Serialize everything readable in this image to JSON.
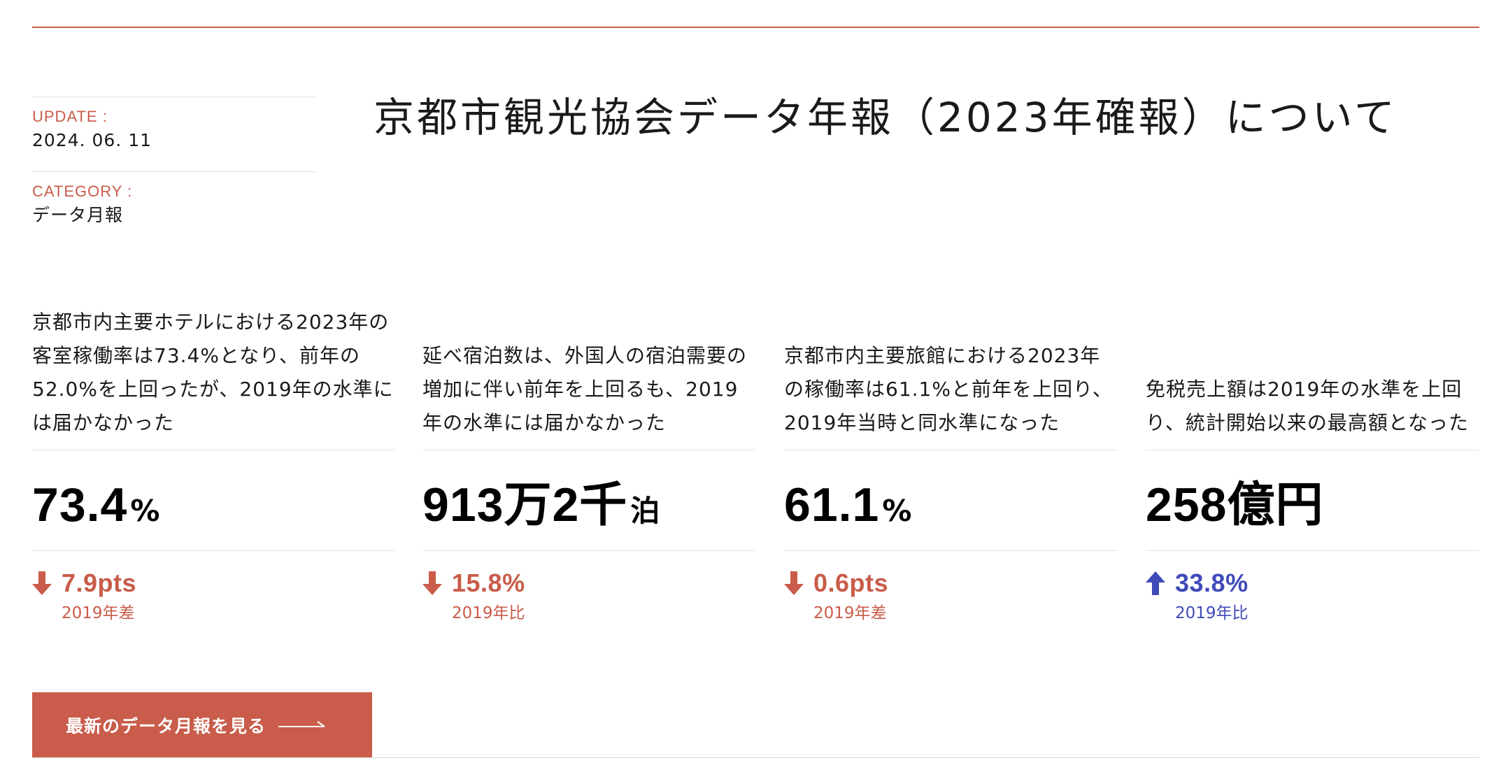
{
  "header": {
    "update_label": "UPDATE :",
    "update_value": "2024. 06. 11",
    "category_label": "CATEGORY :",
    "category_value": "データ月報",
    "title": "京都市観光協会データ年報（2023年確報）について"
  },
  "stats": [
    {
      "description": "京都市内主要ホテルにおける2023年の客室稼働率は73.4%となり、前年の52.0%を上回ったが、2019年の水準には届かなかった",
      "value": "73.4",
      "unit": "%",
      "direction": "down",
      "change": "7.9pts",
      "caption": "2019年差"
    },
    {
      "description": "延べ宿泊数は、外国人の宿泊需要の増加に伴い前年を上回るも、2019年の水準には届かなかった",
      "value": "913万2千",
      "unit": "泊",
      "direction": "down",
      "change": "15.8%",
      "caption": "2019年比"
    },
    {
      "description": "京都市内主要旅館における2023年の稼働率は61.1%と前年を上回り、2019年当時と同水準になった",
      "value": "61.1",
      "unit": "%",
      "direction": "down",
      "change": "0.6pts",
      "caption": "2019年差"
    },
    {
      "description": "免税売上額は2019年の水準を上回り、統計開始以来の最高額となった",
      "value": "258億円",
      "unit": "",
      "direction": "up",
      "change": "33.8%",
      "caption": "2019年比"
    }
  ],
  "cta": {
    "label": "最新のデータ月報を見る",
    "icon": "long-arrow-right-icon"
  },
  "colors": {
    "accent": "#c95c4a",
    "up": "#3f4bb8",
    "text": "#1a1a1a",
    "rule": "#e4e4e4"
  }
}
